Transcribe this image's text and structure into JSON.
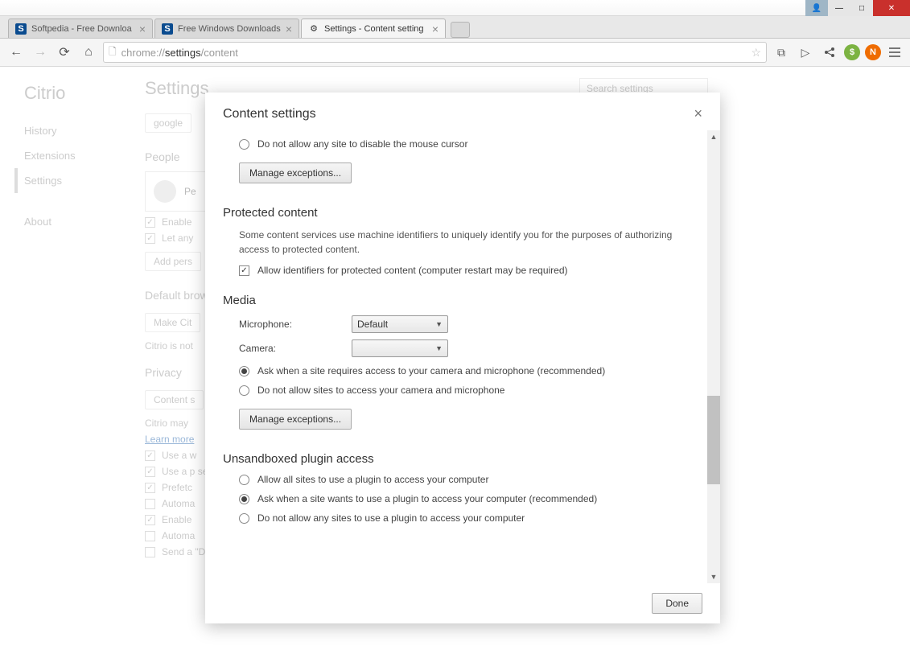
{
  "window": {
    "tabs": [
      {
        "title": "Softpedia - Free Downloa",
        "icon": "S"
      },
      {
        "title": "Free Windows Downloads",
        "icon": "S"
      },
      {
        "title": "Settings - Content setting",
        "icon": "gear"
      }
    ]
  },
  "toolbar": {
    "url_prefix": "chrome://",
    "url_host": "settings",
    "url_path": "/content"
  },
  "settings_bg": {
    "brand": "Citrio",
    "page_title": "Settings",
    "search_placeholder": "Search settings",
    "sidebar": [
      "History",
      "Extensions",
      "Settings",
      "About"
    ],
    "startup_btn": "google",
    "people_heading": "People",
    "person_label": "Pe",
    "enable_guest": "Enable",
    "let_anyone": "Let any",
    "add_person": "Add pers",
    "default_browser_heading": "Default brow",
    "make_default_btn": "Make Cit",
    "default_msg": "Citrio is not",
    "privacy_heading": "Privacy",
    "content_btn": "Content s",
    "privacy_msg": "Citrio may",
    "learn_more": "Learn more",
    "priv_opts": [
      "Use a w",
      "Use a p\nsearch",
      "Prefetc",
      "Automa",
      "Enable",
      "Automa",
      "Send a \"Do Not Track\" request with your browsing traffic"
    ]
  },
  "modal": {
    "title": "Content settings",
    "cursor_radio": "Do not allow any site to disable the mouse cursor",
    "manage_exceptions": "Manage exceptions...",
    "protected_heading": "Protected content",
    "protected_desc": "Some content services use machine identifiers to uniquely identify you for the purposes of authorizing access to protected content.",
    "protected_check": "Allow identifiers for protected content (computer restart may be required)",
    "media_heading": "Media",
    "mic_label": "Microphone:",
    "mic_value": "Default",
    "camera_label": "Camera:",
    "camera_value": "",
    "media_radio1": "Ask when a site requires access to your camera and microphone (recommended)",
    "media_radio2": "Do not allow sites to access your camera and microphone",
    "plugin_heading": "Unsandboxed plugin access",
    "plugin_radio1": "Allow all sites to use a plugin to access your computer",
    "plugin_radio2": "Ask when a site wants to use a plugin to access your computer (recommended)",
    "plugin_radio3": "Do not allow any sites to use a plugin to access your computer",
    "done": "Done"
  }
}
